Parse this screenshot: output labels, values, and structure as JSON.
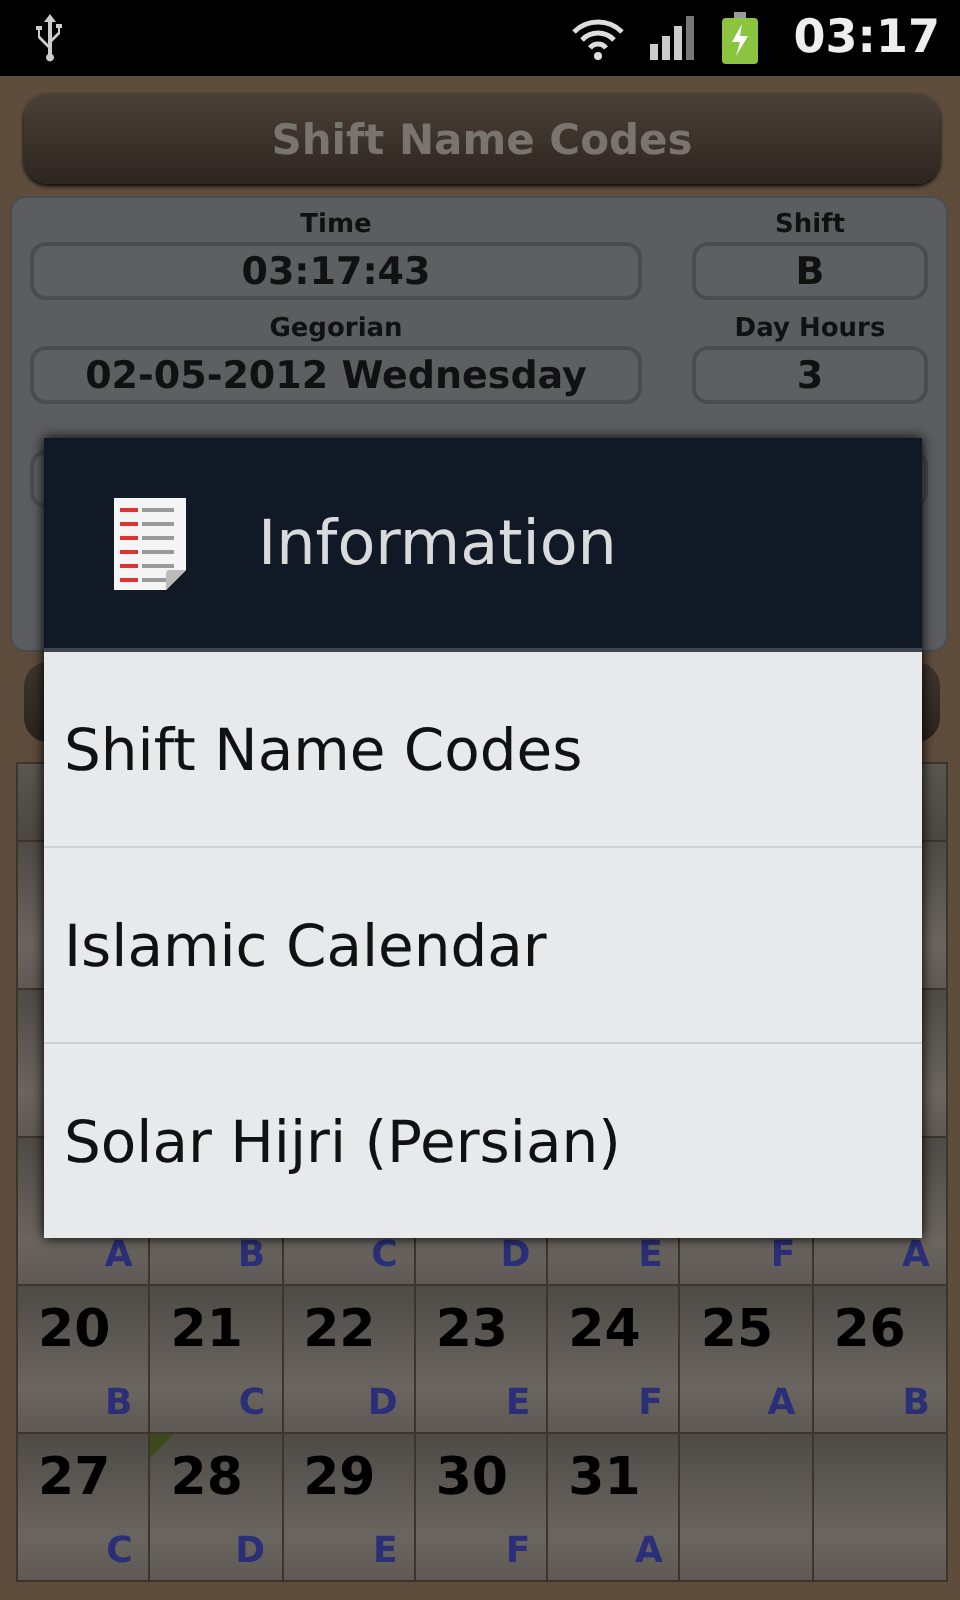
{
  "status_bar": {
    "time": "03:17"
  },
  "header_button": "Shift Name Codes",
  "info_panel": {
    "fields": [
      {
        "label": "Time",
        "value": "03:17:43",
        "side_label": "Shift",
        "side_value": "B"
      },
      {
        "label": "Gegorian",
        "value": "02-05-2012 Wednesday",
        "side_label": "Day Hours",
        "side_value": "3"
      }
    ]
  },
  "calendar": {
    "rows": [
      {
        "cells": [
          {
            "shift": "A"
          },
          {
            "shift": "B"
          },
          {
            "shift": "C"
          },
          {
            "shift": "D"
          },
          {
            "shift": "E"
          },
          {
            "shift": "F"
          },
          {
            "shift": "A"
          }
        ]
      },
      {
        "cells": [
          {
            "day": "20",
            "shift": "B",
            "marked": false
          },
          {
            "day": "21",
            "shift": "C",
            "marked": false
          },
          {
            "day": "22",
            "shift": "D",
            "marked": false
          },
          {
            "day": "23",
            "shift": "E",
            "marked": false
          },
          {
            "day": "24",
            "shift": "F",
            "marked": false
          },
          {
            "day": "25",
            "shift": "A",
            "marked": false
          },
          {
            "day": "26",
            "shift": "B",
            "marked": false
          }
        ]
      },
      {
        "cells": [
          {
            "day": "27",
            "shift": "C",
            "marked": false
          },
          {
            "day": "28",
            "shift": "D",
            "marked": true
          },
          {
            "day": "29",
            "shift": "E",
            "marked": false
          },
          {
            "day": "30",
            "shift": "F",
            "marked": false
          },
          {
            "day": "31",
            "shift": "A",
            "marked": false
          }
        ]
      }
    ]
  },
  "dialog": {
    "title": "Information",
    "items": [
      "Shift Name Codes",
      "Islamic Calendar",
      "Solar Hijri (Persian)"
    ]
  }
}
